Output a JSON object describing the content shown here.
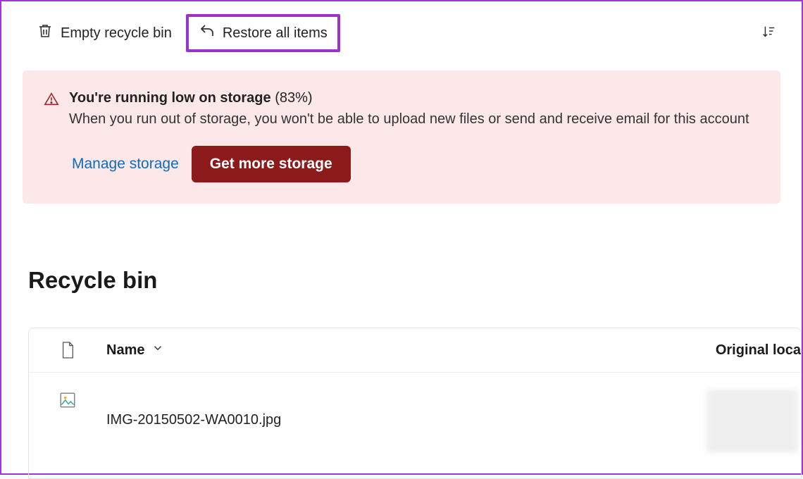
{
  "toolbar": {
    "empty_label": "Empty recycle bin",
    "restore_label": "Restore all items"
  },
  "alert": {
    "title_bold": "You're running low on storage",
    "title_pct": "(83%)",
    "description": "When you run out of storage, you won't be able to upload new files or send and receive email for this account",
    "manage_label": "Manage storage",
    "getmore_label": "Get more storage"
  },
  "page": {
    "title": "Recycle bin"
  },
  "table": {
    "col_name": "Name",
    "col_location": "Original loca",
    "rows": [
      {
        "filename": "IMG-20150502-WA0010.jpg"
      }
    ]
  }
}
